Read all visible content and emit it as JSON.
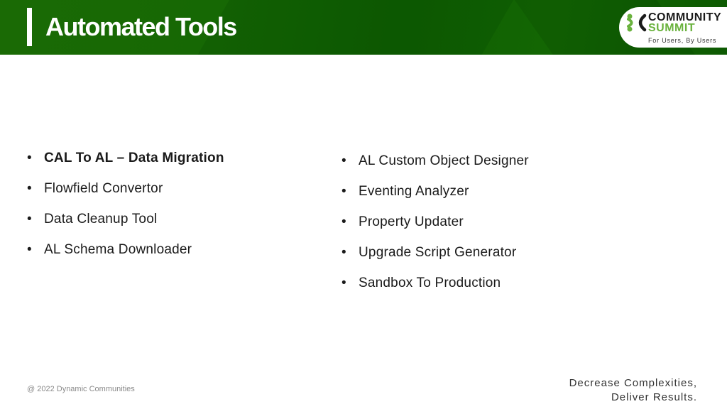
{
  "header": {
    "title": "Automated Tools",
    "brand_color": "#166804"
  },
  "logo": {
    "line1": "COMMUNITY",
    "line2": "SUMMIT",
    "tagline": "For Users, By Users",
    "accent_color": "#6ab23e"
  },
  "content": {
    "left_items": [
      {
        "label": "CAL To AL – Data Migration",
        "bold": true
      },
      {
        "label": "Flowfield Convertor",
        "bold": false
      },
      {
        "label": "Data Cleanup Tool",
        "bold": false
      },
      {
        "label": "AL Schema Downloader",
        "bold": false
      }
    ],
    "right_items": [
      {
        "label": "AL Custom Object Designer"
      },
      {
        "label": "Eventing Analyzer"
      },
      {
        "label": "Property Updater"
      },
      {
        "label": "Upgrade Script Generator"
      },
      {
        "label": "Sandbox To Production"
      }
    ],
    "bullet": "•"
  },
  "footer": {
    "copyright": "@ 2022 Dynamic Communities",
    "tagline_line1": "Decrease Complexities,",
    "tagline_line2": "Deliver Results."
  }
}
